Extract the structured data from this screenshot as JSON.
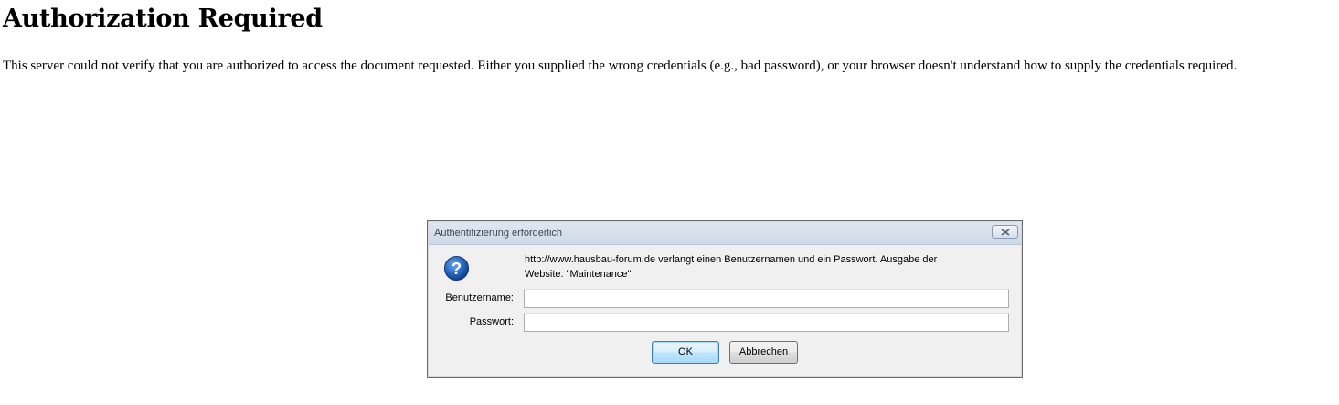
{
  "page": {
    "heading": "Authorization Required",
    "message": "This server could not verify that you are authorized to access the document requested. Either you supplied the wrong credentials (e.g., bad password), or your browser doesn't understand how to supply the credentials required."
  },
  "dialog": {
    "title": "Authentifizierung erforderlich",
    "close_icon": "close-icon",
    "help_icon": "question-icon",
    "prompt_line1": "http://www.hausbau-forum.de verlangt einen Benutzernamen und ein Passwort. Ausgabe der",
    "prompt_line2": "Website: \"Maintenance\"",
    "username_label": "Benutzername:",
    "username_value": "",
    "password_label": "Passwort:",
    "password_value": "",
    "ok_label": "OK",
    "cancel_label": "Abbrechen"
  },
  "colors": {
    "help_icon_blue": "#1f5fb5",
    "ok_border": "#3c7fb1"
  }
}
